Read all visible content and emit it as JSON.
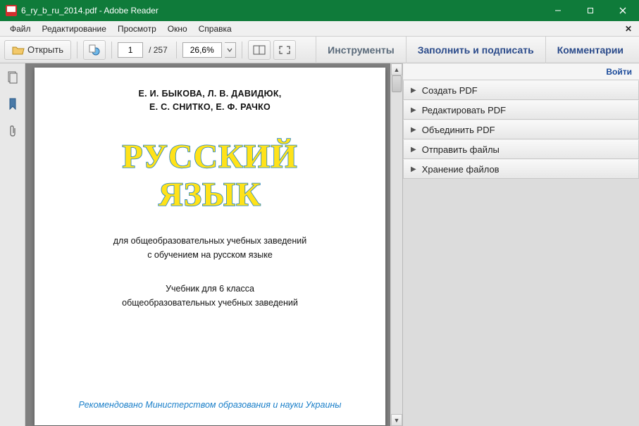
{
  "window": {
    "title": "6_ry_b_ru_2014.pdf - Adobe Reader"
  },
  "menu": {
    "items": [
      "Файл",
      "Редактирование",
      "Просмотр",
      "Окно",
      "Справка"
    ]
  },
  "toolbar": {
    "open_label": "Открыть",
    "page_current": "1",
    "page_total": "/ 257",
    "zoom": "26,6%"
  },
  "panel_tabs": {
    "tools": "Инструменты",
    "fill_sign": "Заполнить и подписать",
    "comments": "Комментарии"
  },
  "sidepanel": {
    "login": "Войти",
    "items": [
      "Создать PDF",
      "Редактировать PDF",
      "Объединить PDF",
      "Отправить файлы",
      "Хранение файлов"
    ]
  },
  "document": {
    "authors_line1": "Е. И. БЫКОВА, Л. В. ДАВИДЮК,",
    "authors_line2": "Е. С. СНИТКО, Е. Ф. РАЧКО",
    "title_line1": "РУССКИЙ",
    "title_line2": "ЯЗЫК",
    "subtitle1a": "для общеобразовательных учебных заведений",
    "subtitle1b": "с обучением на русском языке",
    "subtitle2a": "Учебник для 6 класса",
    "subtitle2b": "общеобразовательных учебных заведений",
    "recommended": "Рекомендовано Министерством образования и науки Украины"
  }
}
